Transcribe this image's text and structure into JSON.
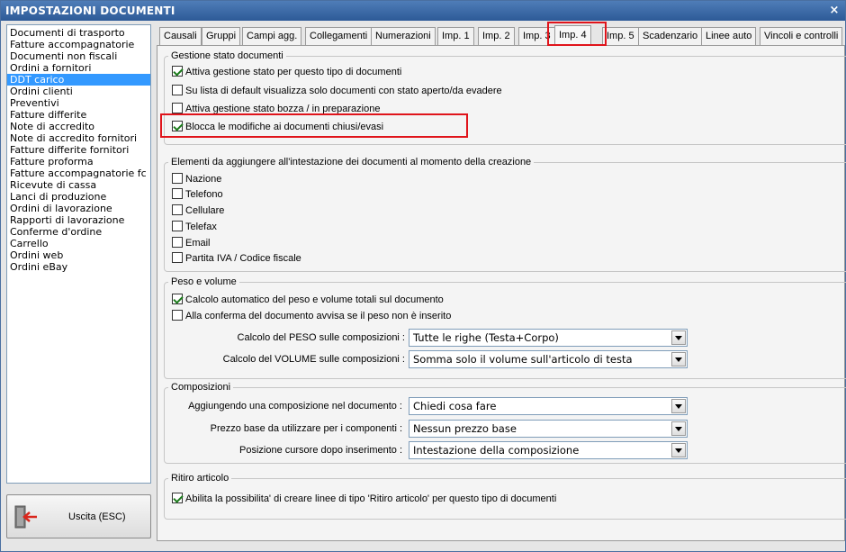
{
  "window": {
    "title": "IMPOSTAZIONI DOCUMENTI",
    "close_label": "×"
  },
  "doc_types": [
    "Documenti di trasporto",
    "Fatture accompagnatorie",
    "Documenti non fiscali",
    "Ordini a fornitori",
    "DDT carico",
    "Ordini clienti",
    "Preventivi",
    "Fatture differite",
    "Note di accredito",
    "Note di accredito fornitori",
    "Fatture differite fornitori",
    "Fatture proforma",
    "Fatture accompagnatorie fc",
    "Ricevute di cassa",
    "Lanci di produzione",
    "Ordini di lavorazione",
    "Rapporti di lavorazione",
    "Conferme d'ordine",
    "Carrello",
    "Ordini web",
    "Ordini eBay"
  ],
  "selected_doc_type": "DDT carico",
  "exit_button": {
    "label": "Uscita (ESC)",
    "icon": "exit-door-icon"
  },
  "tabs": [
    "Causali",
    "Gruppi",
    "Campi agg.",
    "Collegamenti",
    "Numerazioni",
    "Imp. 1",
    "Imp. 2",
    "Imp. 3",
    "Imp. 4",
    "Imp. 5",
    "Scadenzario",
    "Linee auto",
    "Vincoli e controlli"
  ],
  "active_tab": "Imp. 4",
  "stato": {
    "legend": "Gestione stato documenti",
    "options": [
      {
        "label": "Attiva gestione stato per questo tipo di documenti",
        "checked": true
      },
      {
        "label": "Su lista di default visualizza solo documenti con stato aperto/da evadere",
        "checked": false
      },
      {
        "label": "Attiva gestione stato bozza / in preparazione",
        "checked": false
      },
      {
        "label": "Blocca le modifiche ai documenti chiusi/evasi",
        "checked": true
      }
    ]
  },
  "intestazione": {
    "legend": "Elementi da aggiungere all'intestazione dei documenti al momento della creazione",
    "options": [
      {
        "label": "Nazione",
        "checked": false
      },
      {
        "label": "Telefono",
        "checked": false
      },
      {
        "label": "Cellulare",
        "checked": false
      },
      {
        "label": "Telefax",
        "checked": false
      },
      {
        "label": "Email",
        "checked": false
      },
      {
        "label": "Partita IVA / Codice fiscale",
        "checked": false
      }
    ]
  },
  "peso": {
    "legend": "Peso e volume",
    "options": [
      {
        "label": "Calcolo automatico del peso e volume totali sul documento",
        "checked": true
      },
      {
        "label": "Alla conferma del documento avvisa se il peso non è inserito",
        "checked": false
      }
    ],
    "peso_label": "Calcolo del PESO sulle composizioni :",
    "peso_value": "Tutte le righe (Testa+Corpo)",
    "volume_label": "Calcolo del VOLUME sulle composizioni :",
    "volume_value": "Somma solo il volume sull'articolo di testa"
  },
  "composizioni": {
    "legend": "Composizioni",
    "add_label": "Aggiungendo una composizione nel documento :",
    "add_value": "Chiedi cosa fare",
    "price_label": "Prezzo base da utilizzare per i componenti :",
    "price_value": "Nessun prezzo base",
    "cursor_label": "Posizione cursore dopo inserimento :",
    "cursor_value": "Intestazione della composizione"
  },
  "ritiro": {
    "legend": "Ritiro articolo",
    "option": {
      "label": "Abilita la possibilita' di creare linee di tipo 'Ritiro articolo' per questo tipo di documenti",
      "checked": true
    }
  },
  "colors": {
    "titlebar": "#3a68a8",
    "selection": "#3399ff",
    "highlight": "#e0141b",
    "check": "#1a7a1a"
  }
}
